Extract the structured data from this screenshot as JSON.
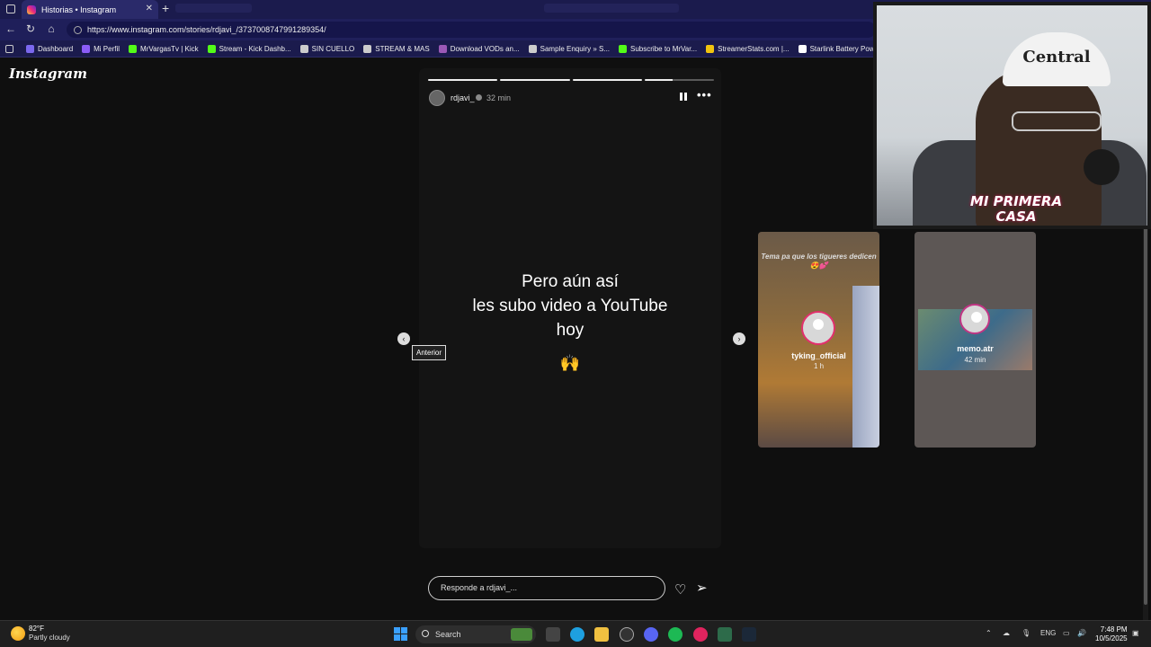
{
  "browser": {
    "tab_title": "Historias • Instagram",
    "new_tab_symbol": "+",
    "url": "https://www.instagram.com/stories/rdjavi_/3737008747991289354/",
    "bookmarks": [
      {
        "label": "Dashboard",
        "color": "#7b68ee"
      },
      {
        "label": "Mi Perfil",
        "color": "#8b5cf6"
      },
      {
        "label": "MrVargasTv | Kick",
        "color": "#53fc18"
      },
      {
        "label": "Stream - Kick Dashb...",
        "color": "#53fc18"
      },
      {
        "label": "SIN CUELLO",
        "color": "#cccccc"
      },
      {
        "label": "STREAM & MAS",
        "color": "#cccccc"
      },
      {
        "label": "Download VODs an...",
        "color": "#9b59b6"
      },
      {
        "label": "Sample Enquiry » S...",
        "color": "#cccccc"
      },
      {
        "label": "Subscribe to MrVar...",
        "color": "#53fc18"
      },
      {
        "label": "StreamerStats.com |...",
        "color": "#f1c40f"
      },
      {
        "label": "Starlink Battery Pow...",
        "color": "#ffffff"
      }
    ]
  },
  "instagram": {
    "logo": "Instagram",
    "story": {
      "username": "rdjavi_",
      "time": "32 min",
      "progress_segments": [
        "full",
        "full",
        "full",
        "part"
      ],
      "text_lines": [
        "Pero aún así",
        "les subo video a YouTube",
        "hoy"
      ],
      "emoji": "🙌",
      "tooltip": "Anterior",
      "reply_placeholder": "Responde a rdjavi_..."
    },
    "next_stories": [
      {
        "caption": "Tema pa que los tigueres dedicen😍💕",
        "username": "tyking_official",
        "time": "1 h"
      },
      {
        "caption": "",
        "username": "memo.atr",
        "time": "42 min"
      }
    ]
  },
  "overlay": {
    "hat_text": "Central",
    "brand_text": "MI PRIMERA CASA"
  },
  "taskbar": {
    "temperature": "82°F",
    "condition": "Partly cloudy",
    "search_placeholder": "Search",
    "language": "ENG",
    "time": "7:48 PM",
    "date": "10/5/2025"
  },
  "colors": {
    "tab_bar": "#1b1b4d",
    "page_bg": "#0f0f0f",
    "story_bg": "#141414"
  }
}
